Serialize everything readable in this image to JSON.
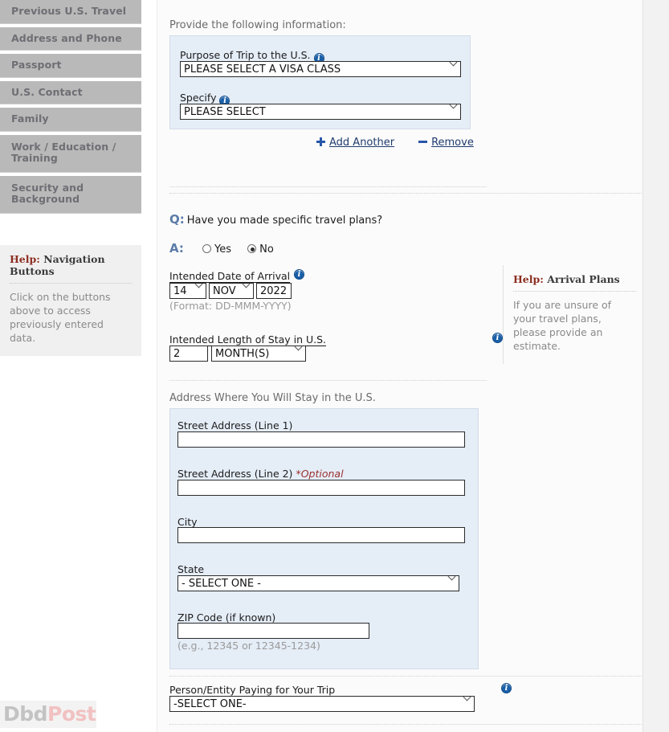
{
  "sidebar": {
    "nav_items": [
      {
        "label": "Previous U.S. Travel"
      },
      {
        "label": "Address and Phone"
      },
      {
        "label": "Passport"
      },
      {
        "label": "U.S. Contact"
      },
      {
        "label": "Family"
      },
      {
        "label": "Work / Education / Training"
      },
      {
        "label": "Security and Background"
      }
    ],
    "help": {
      "title_prefix": "Help:",
      "title_topic": "Navigation Buttons",
      "body": "Click on the buttons above to access previously entered data."
    },
    "watermark": {
      "part1": "Dbd",
      "part2": "Post"
    }
  },
  "main": {
    "lead_text": "Provide the following information:",
    "purpose": {
      "trip_label": "Purpose of Trip to the U.S.",
      "trip_value": "PLEASE SELECT A VISA CLASS",
      "specify_label": "Specify",
      "specify_value": "PLEASE SELECT",
      "add_another_label": "Add Another",
      "remove_label": "Remove"
    },
    "question": {
      "q_marker": "Q:",
      "q_text": "Have you made specific travel plans?",
      "a_marker": "A:",
      "yes_label": "Yes",
      "no_label": "No",
      "selected": "No"
    },
    "arrival": {
      "label": "Intended Date of Arrival",
      "day": "14",
      "month": "NOV",
      "year": "2022",
      "format_hint": "(Format: DD-MMM-YYYY)"
    },
    "stay": {
      "label": "Intended Length of Stay in U.S.",
      "amount": "2",
      "unit": "MONTH(S)"
    },
    "address": {
      "section_label": "Address Where You Will Stay in the U.S.",
      "line1_label": "Street Address (Line 1)",
      "line1_value": "",
      "line2_label": "Street Address (Line 2)",
      "line2_optional": "*Optional",
      "line2_value": "",
      "city_label": "City",
      "city_value": "",
      "state_label": "State",
      "state_value": "- SELECT ONE -",
      "zip_label": "ZIP Code (if known)",
      "zip_value": "",
      "zip_hint": "(e.g., 12345 or 12345-1234)"
    },
    "payer": {
      "label": "Person/Entity Paying for Your Trip",
      "value": "-SELECT ONE-"
    },
    "help": {
      "title_prefix": "Help:",
      "title_topic": "Arrival Plans",
      "body": "If you are unsure of your travel plans, please provide an estimate."
    },
    "info_icon_glyph": "i"
  }
}
